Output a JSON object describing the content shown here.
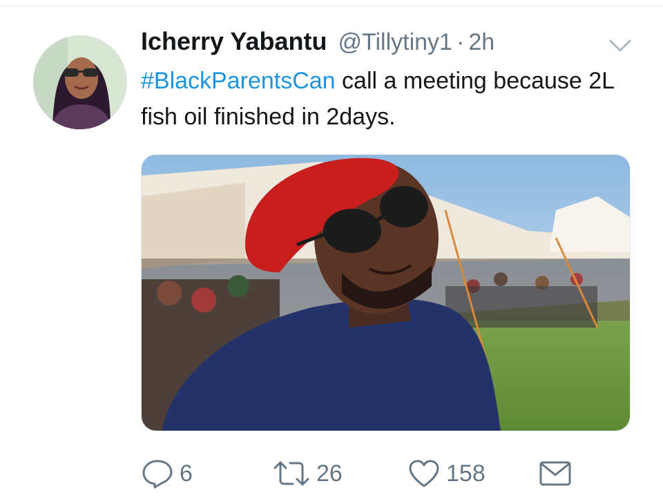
{
  "tweet": {
    "display_name": "Icherry Yabantu",
    "handle": "@Tillytiny1",
    "separator": "·",
    "time": "2h",
    "hashtag": "#BlackParentsCan",
    "text_rest": " call a meeting because 2L fish oil finished in 2days."
  },
  "actions": {
    "reply_count": "6",
    "retweet_count": "26",
    "like_count": "158"
  },
  "icons": {
    "menu": "chevron-down-icon",
    "reply": "reply-icon",
    "retweet": "retweet-icon",
    "like": "heart-icon",
    "message": "envelope-icon"
  },
  "colors": {
    "link": "#1b95e0",
    "secondary_text": "#657786",
    "primary_text": "#14171a"
  }
}
